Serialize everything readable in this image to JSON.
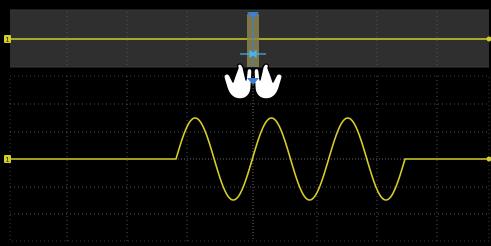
{
  "screen": {
    "channel_label": "1",
    "colors": {
      "background": "#000000",
      "overview_band": "#2f2f2f",
      "trace": "#d6cf2a",
      "trigger_marker": "#3f7fd0",
      "zoom_arrows": "#4ab3e6",
      "grid": "#555555"
    },
    "overview": {
      "label": "overview-waveform-strip",
      "trace": "flat",
      "zoom_window_icon": "zoom-window-handle"
    },
    "main": {
      "trace": "sine-burst",
      "cycles": 3
    },
    "gesture_icon": "two-finger-pinch-icon"
  }
}
